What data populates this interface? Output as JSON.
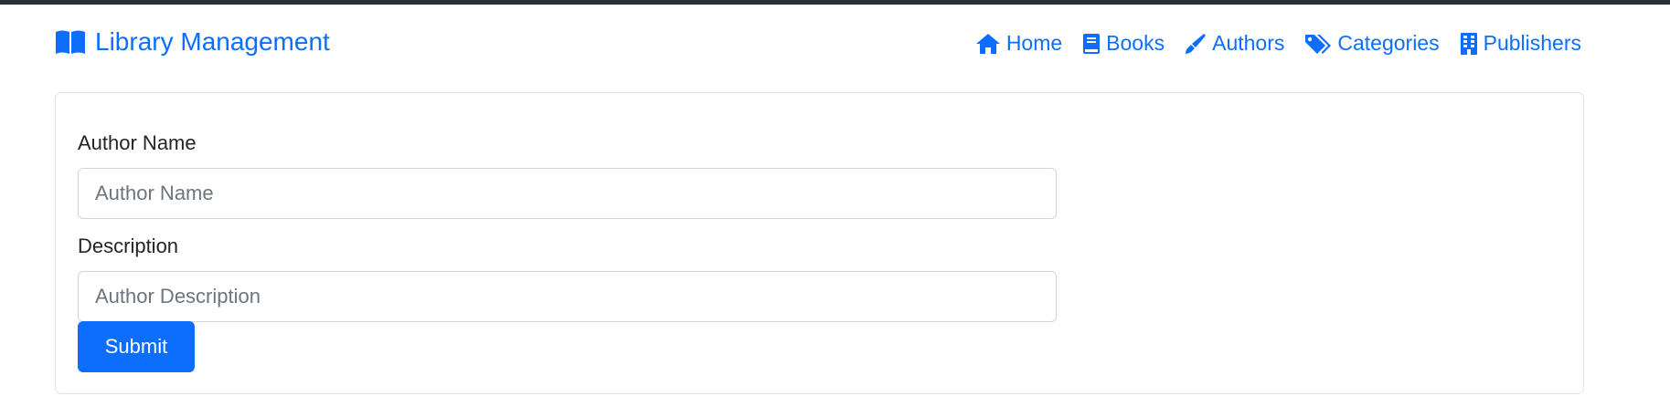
{
  "navbar": {
    "brand": {
      "label": "Library Management",
      "icon": "book-open-icon"
    },
    "links": [
      {
        "label": "Home",
        "icon": "home-icon"
      },
      {
        "label": "Books",
        "icon": "book-icon"
      },
      {
        "label": "Authors",
        "icon": "pen-nib-icon"
      },
      {
        "label": "Categories",
        "icon": "tags-icon"
      },
      {
        "label": "Publishers",
        "icon": "building-icon"
      }
    ]
  },
  "form": {
    "author_name_label": "Author Name",
    "author_name_placeholder": "Author Name",
    "author_name_value": "",
    "description_label": "Description",
    "description_placeholder": "Author Description",
    "description_value": "",
    "submit_label": "Submit"
  },
  "colors": {
    "accent": "#0d6efd",
    "top_bar": "#2b3035",
    "border": "#dfe2e6",
    "text": "#212529",
    "placeholder": "#6c757d"
  }
}
